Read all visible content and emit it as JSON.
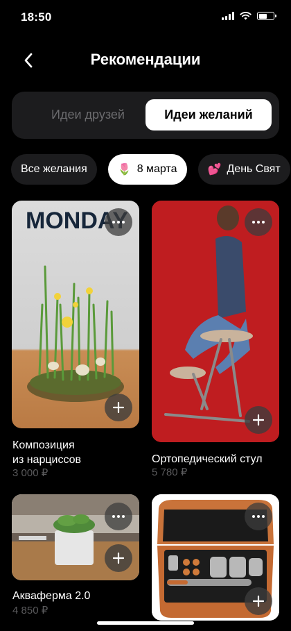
{
  "status": {
    "time": "18:50"
  },
  "header": {
    "title": "Рекомендации"
  },
  "tabs": [
    {
      "label": "Идеи друзей",
      "active": false
    },
    {
      "label": "Идеи желаний",
      "active": true
    }
  ],
  "chips": [
    {
      "label": "Все желания",
      "emoji": "",
      "active": false
    },
    {
      "label": "8 марта",
      "emoji": "🌷",
      "active": true
    },
    {
      "label": "День Свят",
      "emoji": "💕",
      "active": false
    }
  ],
  "products": [
    {
      "title_line1": "Композиция",
      "title_line2": "из нарциссов",
      "price": "3 000 ₽",
      "image_text": "MONDAY"
    },
    {
      "title_line1": "Ортопедический стул",
      "title_line2": "",
      "price": "5 780 ₽"
    },
    {
      "title_line1": "Акваферма 2.0",
      "title_line2": "",
      "price": "4 850 ₽"
    },
    {
      "title_line1": "",
      "title_line2": "",
      "price": ""
    }
  ],
  "colors": {
    "background": "#000000",
    "surface": "#1c1c1e",
    "muted": "#5a5a5c",
    "accent": "#ffffff"
  }
}
